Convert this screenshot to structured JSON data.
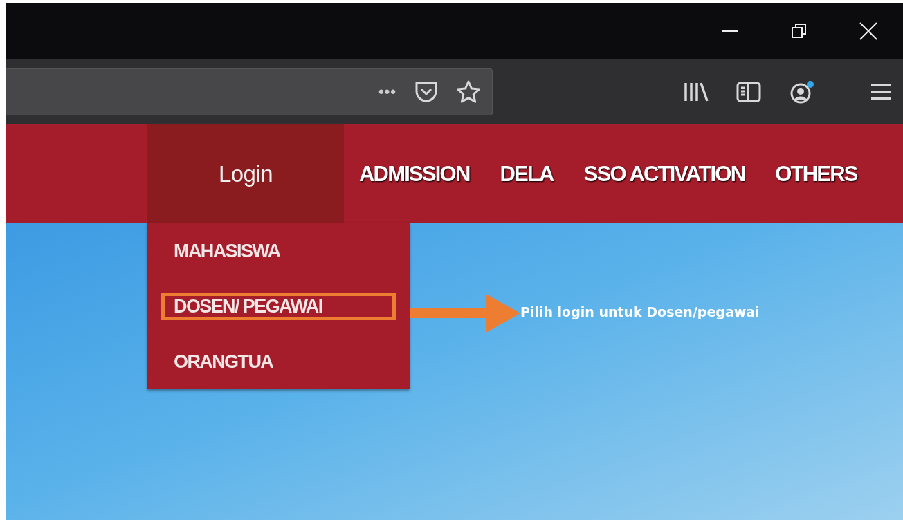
{
  "browser": {
    "url_bar_icons": [
      "•••"
    ]
  },
  "nav": {
    "items": [
      {
        "label": "Login",
        "selected": true
      },
      {
        "label": "ADMISSION",
        "selected": false
      },
      {
        "label": "DELA",
        "selected": false
      },
      {
        "label": "SSO ACTIVATION",
        "selected": false
      },
      {
        "label": "OTHERS",
        "selected": false
      }
    ]
  },
  "login_menu": {
    "expanded": true,
    "items": [
      {
        "label": "MAHASISWA",
        "highlighted": false
      },
      {
        "label": "DOSEN/ PEGAWAI",
        "highlighted": true
      },
      {
        "label": "ORANGTUA",
        "highlighted": false
      }
    ]
  },
  "annotation": {
    "text": "Pilih login untuk Dosen/pegawai"
  }
}
